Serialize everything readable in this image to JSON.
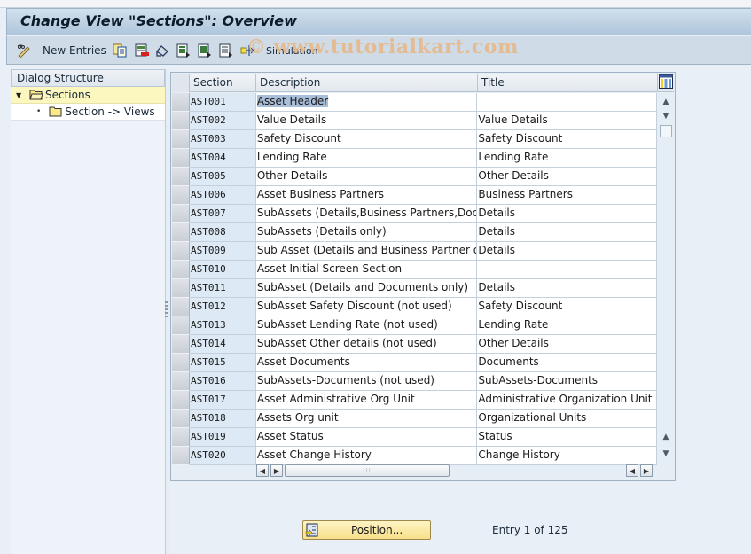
{
  "window": {
    "title": "Change View \"Sections\": Overview",
    "watermark": "© www.tutorialkart.com"
  },
  "toolbar": {
    "items": [
      {
        "icon": "edit-toggle-icon",
        "label": ""
      },
      {
        "icon": "",
        "label": "New Entries"
      },
      {
        "icon": "copy-as-icon",
        "label": ""
      },
      {
        "icon": "delete-icon",
        "label": ""
      },
      {
        "icon": "undo-change-icon",
        "label": ""
      },
      {
        "icon": "select-all-icon",
        "label": ""
      },
      {
        "icon": "select-block-icon",
        "label": ""
      },
      {
        "icon": "deselect-all-icon",
        "label": ""
      },
      {
        "icon": "bc-set-icon",
        "label": ""
      },
      {
        "icon": "",
        "label": "Simulation"
      }
    ],
    "new_entries_label": "New Entries",
    "simulation_label": "Simulation"
  },
  "dialog_structure": {
    "header": "Dialog Structure",
    "nodes": [
      {
        "label": "Sections",
        "expanded": true,
        "selected": true,
        "level": 0
      },
      {
        "label": "Section -> Views",
        "expanded": false,
        "selected": false,
        "level": 1
      }
    ]
  },
  "table": {
    "columns": [
      "Section",
      "Description",
      "Title"
    ],
    "rows": [
      {
        "section": "AST001",
        "description": "Asset Header",
        "title": ""
      },
      {
        "section": "AST002",
        "description": "Value Details",
        "title": "Value Details"
      },
      {
        "section": "AST003",
        "description": "Safety Discount",
        "title": "Safety Discount"
      },
      {
        "section": "AST004",
        "description": "Lending Rate",
        "title": "Lending Rate"
      },
      {
        "section": "AST005",
        "description": "Other Details",
        "title": "Other Details"
      },
      {
        "section": "AST006",
        "description": "Asset Business Partners",
        "title": "Business Partners"
      },
      {
        "section": "AST007",
        "description": "SubAssets (Details,Business Partners,Docum…",
        "title": "Details"
      },
      {
        "section": "AST008",
        "description": "SubAssets (Details only)",
        "title": "Details"
      },
      {
        "section": "AST009",
        "description": "Sub Asset (Details and Business Partner only)",
        "title": "Details"
      },
      {
        "section": "AST010",
        "description": "Asset Initial Screen Section",
        "title": ""
      },
      {
        "section": "AST011",
        "description": "SubAsset (Details and Documents only)",
        "title": "Details"
      },
      {
        "section": "AST012",
        "description": "SubAsset Safety Discount (not used)",
        "title": "Safety Discount"
      },
      {
        "section": "AST013",
        "description": "SubAsset Lending Rate (not used)",
        "title": "Lending Rate"
      },
      {
        "section": "AST014",
        "description": "SubAsset Other details (not used)",
        "title": "Other Details"
      },
      {
        "section": "AST015",
        "description": "Asset Documents",
        "title": "Documents"
      },
      {
        "section": "AST016",
        "description": "SubAssets-Documents (not used)",
        "title": "SubAssets-Documents"
      },
      {
        "section": "AST017",
        "description": "Asset Administrative Org Unit",
        "title": "Administrative Organization Unit"
      },
      {
        "section": "AST018",
        "description": "Assets Org unit",
        "title": "Organizational Units"
      },
      {
        "section": "AST019",
        "description": "Asset Status",
        "title": "Status"
      },
      {
        "section": "AST020",
        "description": "Asset Change History",
        "title": "Change History"
      }
    ],
    "highlighted_row": 0
  },
  "footer": {
    "position_button": "Position...",
    "entry_info": "Entry 1 of 125"
  }
}
